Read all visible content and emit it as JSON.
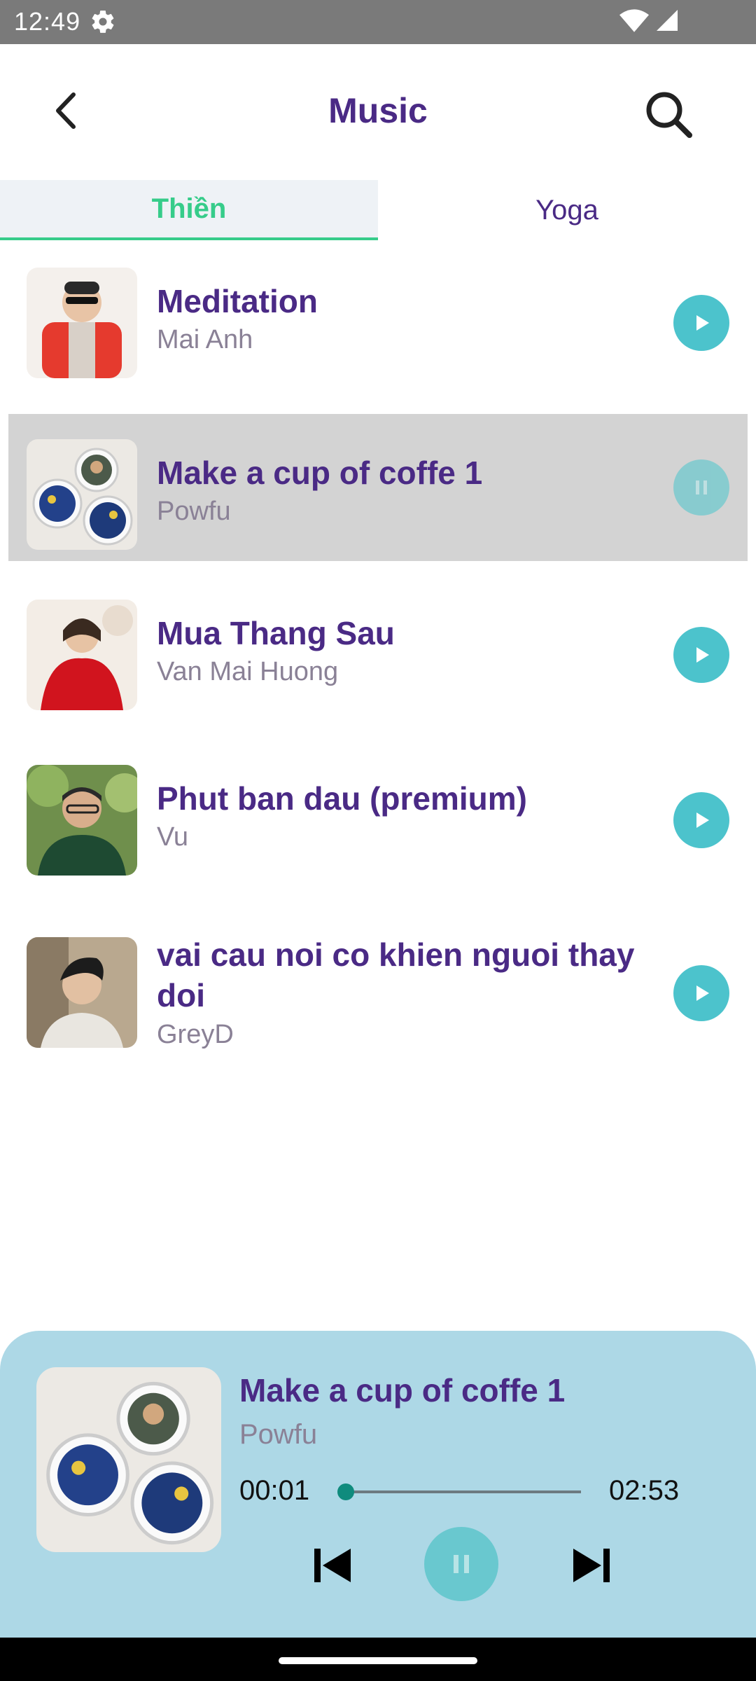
{
  "status_bar": {
    "time": "12:49",
    "icons": [
      "gear-icon",
      "wifi-icon",
      "signal-icon"
    ]
  },
  "header": {
    "title": "Music",
    "back_icon": "chevron-left-icon",
    "search_icon": "search-icon"
  },
  "tabs": [
    {
      "label": "Thiền",
      "active": true
    },
    {
      "label": "Yoga",
      "active": false
    }
  ],
  "tracks": [
    {
      "title": "Meditation",
      "artist": "Mai Anh",
      "state": "play"
    },
    {
      "title": "Make a cup of coffe 1",
      "artist": "Powfu",
      "state": "playing"
    },
    {
      "title": "Mua Thang Sau",
      "artist": "Van Mai Huong",
      "state": "play"
    },
    {
      "title": "Phut ban dau (premium)",
      "artist": "Vu",
      "state": "play"
    },
    {
      "title": "vai cau noi co khien nguoi thay doi",
      "artist": "GreyD",
      "state": "play"
    }
  ],
  "player": {
    "title": "Make a cup of coffe 1",
    "artist": "Powfu",
    "current_time": "00:01",
    "total_time": "02:53",
    "progress": 0.006
  },
  "colors": {
    "brand_purple": "#4a2a85",
    "accent_green": "#36cc8a",
    "play_teal": "#4cc3cc",
    "player_bg": "#add8e6",
    "selected_row": "#d3d3d3"
  }
}
